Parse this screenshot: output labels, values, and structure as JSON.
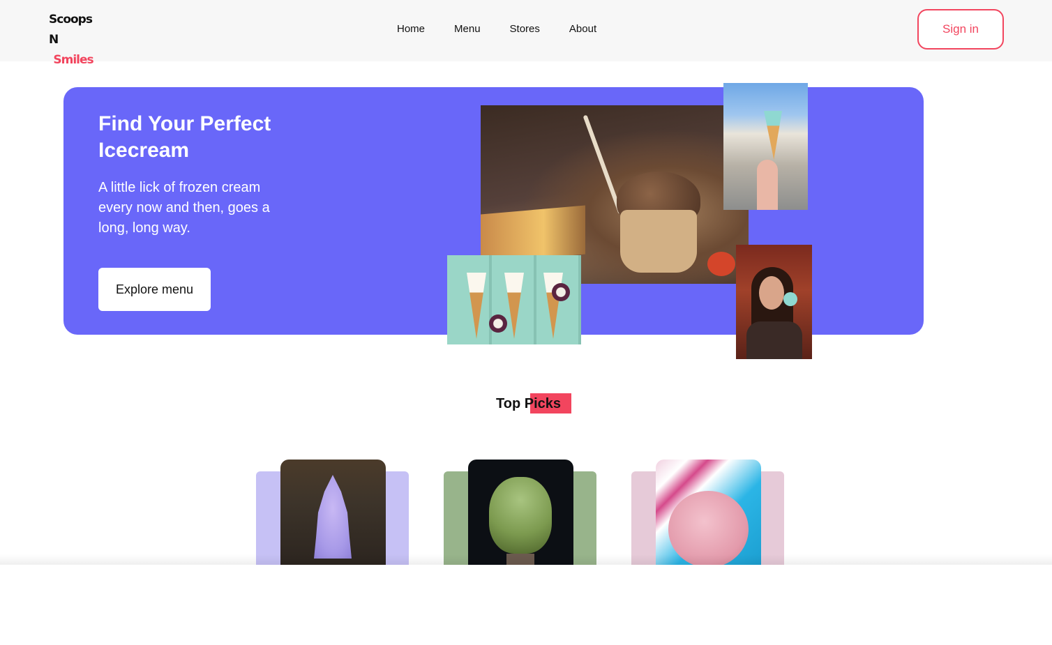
{
  "brand": {
    "line1": "Scoops N",
    "line2": "Smiles",
    "accent": "#f2455e"
  },
  "nav": {
    "items": [
      {
        "label": "Home"
      },
      {
        "label": "Menu"
      },
      {
        "label": "Stores"
      },
      {
        "label": "About"
      }
    ]
  },
  "signin_label": "Sign in",
  "hero": {
    "title": "Find Your Perfect Icecream",
    "subtitle": "A little lick of frozen cream every now and then, goes a long, long way.",
    "cta": "Explore menu",
    "background": "#6967f9"
  },
  "top_picks": {
    "heading": "Top Picks"
  },
  "picks": [
    {
      "card_color": "#c6c1f5",
      "image": "lavender-soft-serve"
    },
    {
      "card_color": "#98b48b",
      "image": "pistachio-cone"
    },
    {
      "card_color": "#e6cad8",
      "image": "strawberry-scoops"
    }
  ]
}
